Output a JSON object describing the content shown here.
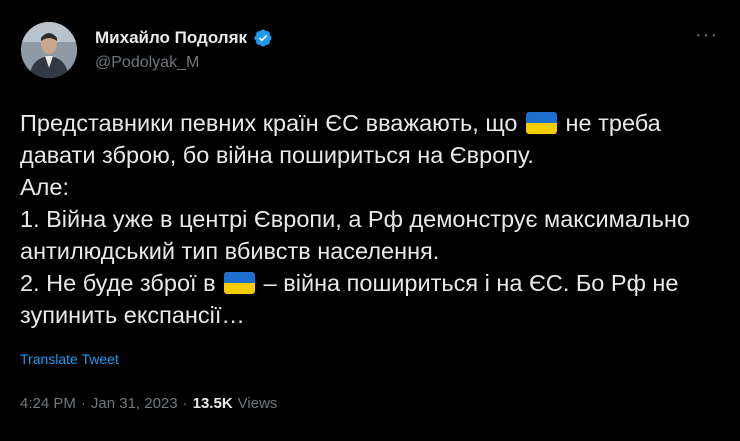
{
  "author": {
    "name": "Михайло Подоляк",
    "handle": "@Podolyak_M",
    "verified": true,
    "verified_color": "#1d9bf0"
  },
  "more_icon": "more-horizontal-icon",
  "body": {
    "line1_before_flag": "Представники певних країн ЄС вважають, що ",
    "line1_after_flag": " не треба давати зброю, бо війна пошириться на Європу.",
    "line2": "Але:",
    "line3": "1. Війна уже в центрі Європи, а Рф демонструє максимально антилюдський тип вбивств населення.",
    "line4_before_flag": "2. Не буде зброї в ",
    "line4_after_flag": " – війна пошириться і на ЄС. Бо Рф не зупинить експансії…",
    "flag_emoji": "ukraine-flag"
  },
  "translate_label": "Translate Tweet",
  "meta": {
    "time": "4:24 PM",
    "separator": "·",
    "date": "Jan 31, 2023",
    "views_count": "13.5K",
    "views_label": "Views"
  },
  "colors": {
    "background": "#000000",
    "text": "#e7e9ea",
    "secondary": "#71767b",
    "link": "#1d9bf0"
  }
}
